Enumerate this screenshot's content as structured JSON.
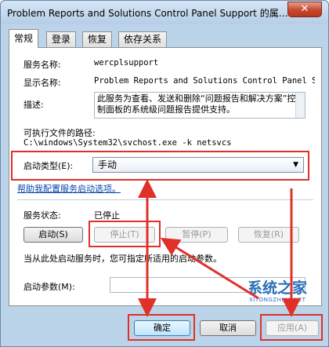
{
  "window": {
    "title": "Problem Reports and Solutions Control Panel Support 的属…",
    "close_label": "✕"
  },
  "tabs": [
    {
      "label": "常规"
    },
    {
      "label": "登录"
    },
    {
      "label": "恢复"
    },
    {
      "label": "依存关系"
    }
  ],
  "general": {
    "service_name_label": "服务名称:",
    "service_name_value": "wercplsupport",
    "display_name_label": "显示名称:",
    "display_name_value": "Problem Reports and Solutions Control Panel S",
    "description_label": "描述:",
    "description_value": "此服务为查看、发送和删除“问题报告和解决方案”控制面板的系统级问题报告提供支持。",
    "exe_path_label": "可执行文件的路径:",
    "exe_path_value": "C:\\windows\\System32\\svchost.exe -k netsvcs",
    "startup_type_label": "启动类型(E):",
    "startup_type_value": "手动",
    "help_link": "帮助我配置服务启动选项。",
    "status_label": "服务状态:",
    "status_value": "已停止",
    "start_button": "启动(S)",
    "stop_button": "停止(T)",
    "pause_button": "暂停(P)",
    "resume_button": "恢复(R)",
    "hint_text": "当从此处启动服务时，您可指定所适用的启动参数。",
    "params_label": "启动参数(M):"
  },
  "footer": {
    "ok_button": "确定",
    "cancel_button": "取消",
    "apply_button": "应用(A)"
  },
  "watermark": {
    "text": "系统之家",
    "sub": "XITONGZHIJIA.NET"
  },
  "colors": {
    "highlight": "#e0302a",
    "link": "#0645ad"
  }
}
